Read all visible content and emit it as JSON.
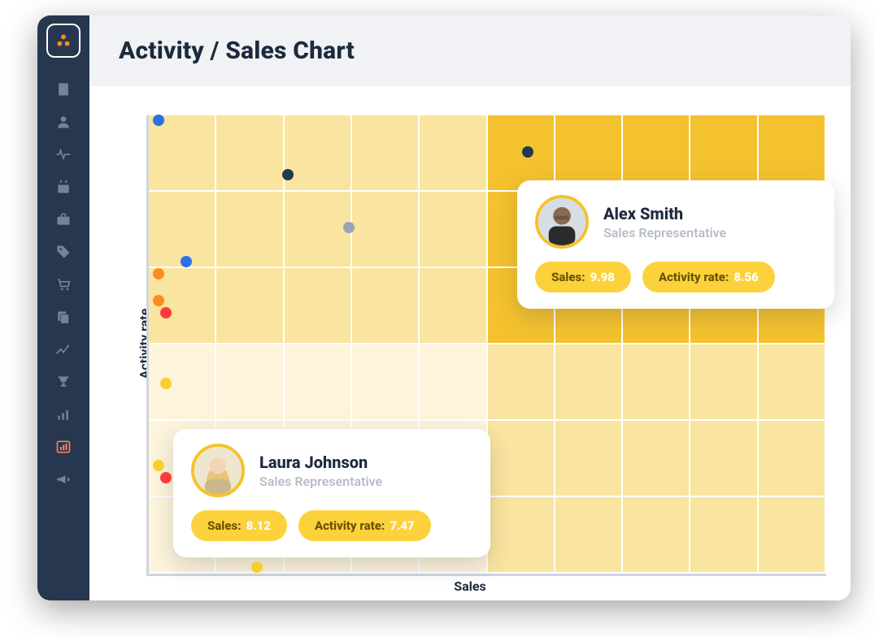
{
  "header": {
    "title": "Activity / Sales Chart"
  },
  "axes": {
    "x": "Sales",
    "y": "Activity rate"
  },
  "sidebar": {
    "icons": [
      "building",
      "user",
      "pulse",
      "calendar",
      "briefcase",
      "tag",
      "cart",
      "copy",
      "trend",
      "trophy",
      "bar-chart",
      "stats-active",
      "megaphone"
    ]
  },
  "chart_data": {
    "type": "scatter",
    "xlabel": "Sales",
    "ylabel": "Activity rate",
    "xlim": [
      0,
      10
    ],
    "ylim": [
      0,
      10
    ],
    "quadrant_split": {
      "x": 5,
      "y": 5
    },
    "series": [
      {
        "name": "blue",
        "color": "#2e6fe8",
        "points": [
          {
            "x": 0.15,
            "y": 9.9
          },
          {
            "x": 0.55,
            "y": 6.8
          }
        ]
      },
      {
        "name": "navy",
        "color": "#1f3a52",
        "points": [
          {
            "x": 2.05,
            "y": 8.7
          },
          {
            "x": 5.6,
            "y": 9.2
          }
        ]
      },
      {
        "name": "gray",
        "color": "#99a4b3",
        "points": [
          {
            "x": 2.95,
            "y": 7.55
          }
        ]
      },
      {
        "name": "orange",
        "color": "#ff8a1f",
        "points": [
          {
            "x": 0.15,
            "y": 6.55
          },
          {
            "x": 0.15,
            "y": 5.95
          }
        ]
      },
      {
        "name": "red",
        "color": "#ff3a3a",
        "points": [
          {
            "x": 0.25,
            "y": 5.7
          },
          {
            "x": 0.25,
            "y": 2.1
          }
        ]
      },
      {
        "name": "yellow",
        "color": "#f8cf2d",
        "points": [
          {
            "x": 0.25,
            "y": 4.15
          },
          {
            "x": 0.15,
            "y": 2.35
          },
          {
            "x": 1.6,
            "y": 0.15
          }
        ]
      }
    ]
  },
  "tooltip_labels": {
    "sales": "Sales:",
    "activity": "Activity rate:"
  },
  "tooltips": [
    {
      "name": "Alex Smith",
      "role": "Sales Representative",
      "sales": "9.98",
      "activity": "8.56",
      "avatar_kind": "male"
    },
    {
      "name": "Laura Johnson",
      "role": "Sales Representative",
      "sales": "8.12",
      "activity": "7.47",
      "avatar_kind": "female"
    }
  ]
}
